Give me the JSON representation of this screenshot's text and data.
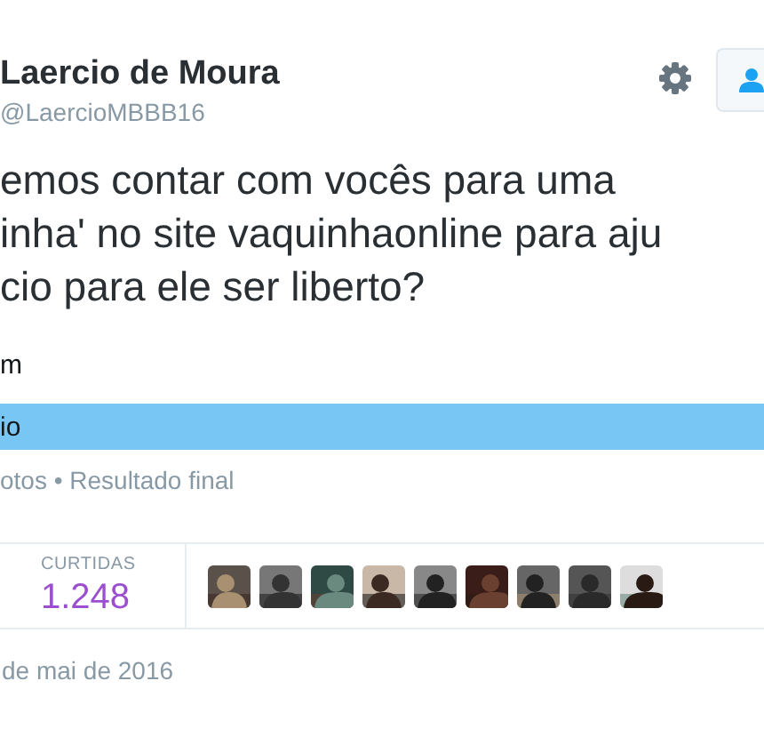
{
  "author": {
    "name": "Laercio de Moura",
    "handle": "@LaercioMBBB16"
  },
  "tweet_lines": [
    "emos contar com vocês para uma",
    "inha' no site vaquinhaonline para aju",
    "cio para ele ser liberto?"
  ],
  "poll": {
    "options": [
      {
        "label": "m"
      },
      {
        "label": "io",
        "level": 1
      }
    ],
    "footer": "otos • Resultado final"
  },
  "stats": {
    "label": "CURTIDAS",
    "value": "1.248"
  },
  "date": "de mai de 2016"
}
